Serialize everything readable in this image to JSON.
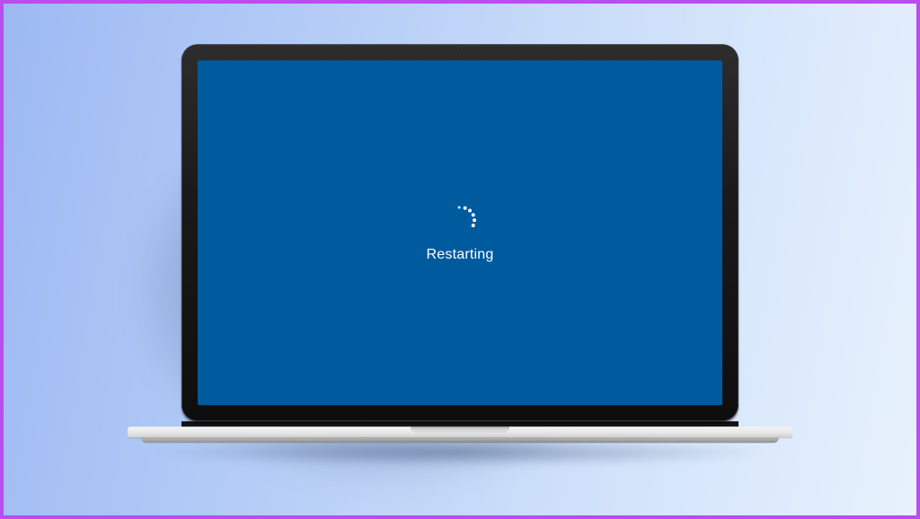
{
  "screen": {
    "status_text": "Restarting",
    "background_color": "#005a9e"
  },
  "frame": {
    "border_color": "#b84df0"
  }
}
